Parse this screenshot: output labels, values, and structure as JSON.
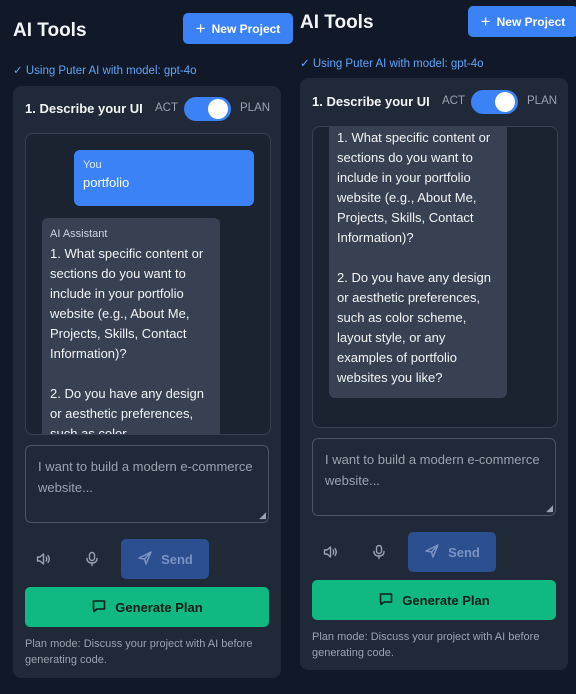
{
  "app": {
    "title": "AI Tools",
    "new_project_label": "New Project",
    "model_status": "✓ Using Puter AI with model: gpt-4o"
  },
  "panel": {
    "title": "1. Describe your UI",
    "act_label": "ACT",
    "plan_label": "PLAN",
    "mode": "PLAN"
  },
  "chat": {
    "user": {
      "label": "You",
      "text": "portfolio"
    },
    "assistant": {
      "label": "AI Assistant",
      "text_left": "1. What specific content or sections do you want to include in your portfolio website (e.g., About Me, Projects, Skills, Contact Information)?\n\n2. Do you have any design or aesthetic preferences, such as color",
      "text_right": "1. What specific content or sections do you want to include in your portfolio website (e.g., About Me, Projects, Skills, Contact Information)?\n\n2. Do you have any design or aesthetic preferences, such as color scheme, layout style, or any examples of portfolio websites you like?"
    }
  },
  "input": {
    "placeholder": "I want to build a modern e-commerce website..."
  },
  "controls": {
    "speaker_icon": "speaker-icon",
    "mic_icon": "microphone-icon",
    "send_label": "Send"
  },
  "generate": {
    "label": "Generate Plan"
  },
  "footnote": "Plan mode: Discuss your project with AI before generating code.",
  "colors": {
    "background": "#111827",
    "panel": "#1f2937",
    "accent_blue": "#3b82f6",
    "accent_green": "#10b981",
    "link_blue": "#60a5fa"
  }
}
